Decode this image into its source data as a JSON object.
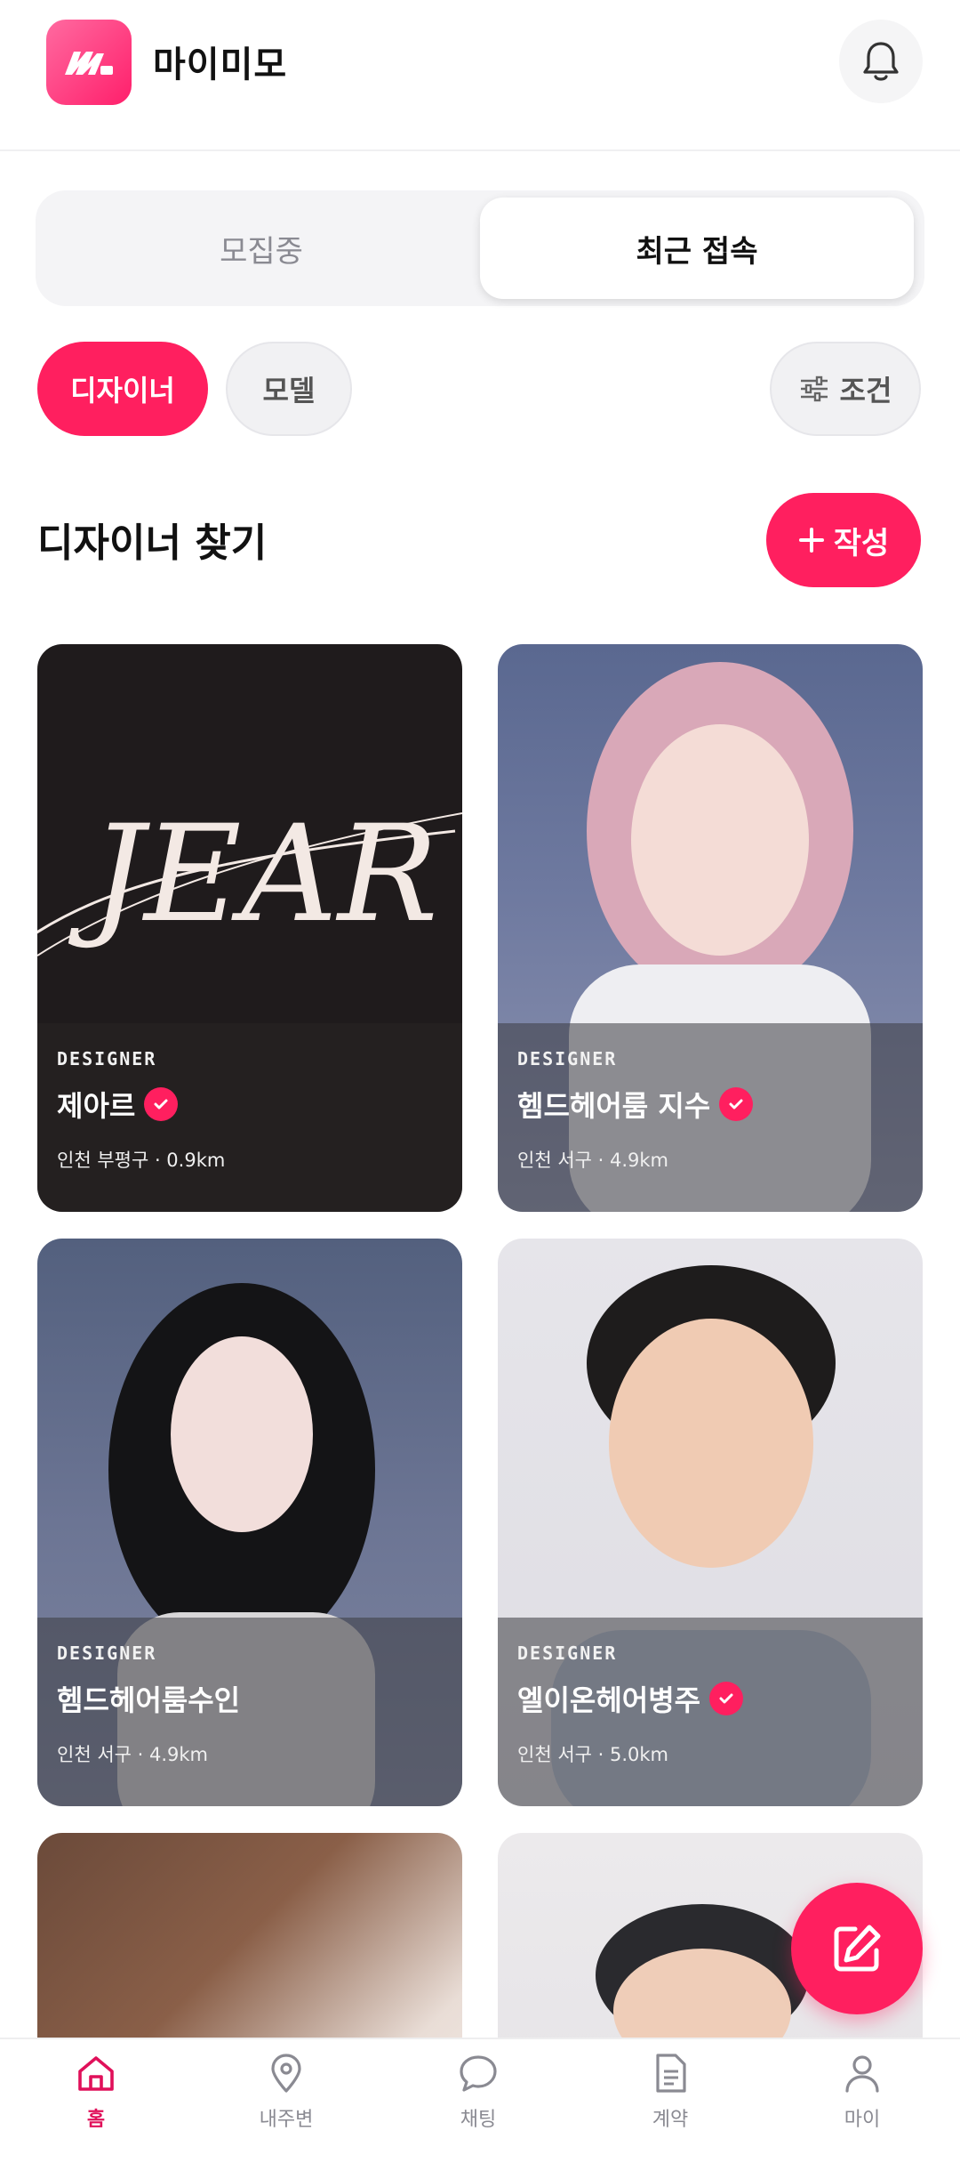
{
  "header": {
    "app_name": "마이미모"
  },
  "tabs": [
    {
      "label": "모집중",
      "active": false
    },
    {
      "label": "최근 접속",
      "active": true
    }
  ],
  "filters": {
    "designer": "디자이너",
    "model": "모델",
    "condition": "조건"
  },
  "section": {
    "title": "디자이너 찾기",
    "write_label": "작성"
  },
  "cards": [
    {
      "role": "DESIGNER",
      "name": "제아르",
      "verified": true,
      "location": "인천 부평구 · 0.9km",
      "logo_text": "JEAR"
    },
    {
      "role": "DESIGNER",
      "name": "헴드헤어룸 지수",
      "verified": true,
      "location": "인천 서구 · 4.9km"
    },
    {
      "role": "DESIGNER",
      "name": "헴드헤어룸수인",
      "verified": false,
      "location": "인천 서구 · 4.9km"
    },
    {
      "role": "DESIGNER",
      "name": "엘이온헤어병주",
      "verified": true,
      "location": "인천 서구 · 5.0km"
    }
  ],
  "nav": [
    {
      "label": "홈",
      "icon": "home-icon",
      "active": true
    },
    {
      "label": "내주변",
      "icon": "location-pin-icon",
      "active": false
    },
    {
      "label": "채팅",
      "icon": "chat-bubble-icon",
      "active": false
    },
    {
      "label": "계약",
      "icon": "document-icon",
      "active": false
    },
    {
      "label": "마이",
      "icon": "person-icon",
      "active": false
    }
  ],
  "colors": {
    "accent": "#ff1f5f",
    "nav_active": "#e0105a"
  }
}
